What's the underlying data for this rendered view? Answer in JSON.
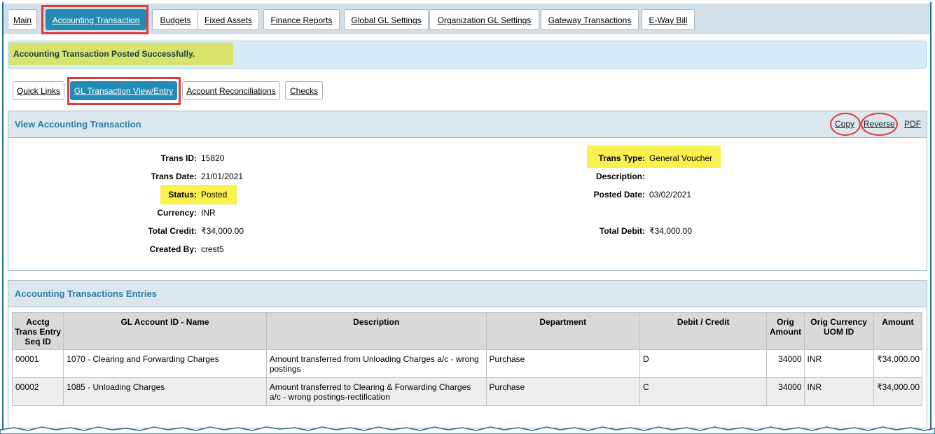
{
  "main_tabs": [
    {
      "label": "Main"
    },
    {
      "label": "Accounting Transaction"
    },
    {
      "label": "Budgets"
    },
    {
      "label": "Fixed Assets"
    },
    {
      "label": "Finance Reports"
    },
    {
      "label": "Global GL Settings"
    },
    {
      "label": "Organization GL Settings"
    },
    {
      "label": "Gateway Transactions"
    },
    {
      "label": "E-Way Bill"
    }
  ],
  "alert": {
    "message": "Accounting Transaction Posted Successfully."
  },
  "sub_tabs": [
    {
      "label": "Quick Links"
    },
    {
      "label": "GL Transaction View/Entry"
    },
    {
      "label": "Account Reconciliations"
    },
    {
      "label": "Checks"
    }
  ],
  "view_panel": {
    "title": "View Accounting Transaction",
    "actions": {
      "copy": "Copy",
      "reverse": "Reverse",
      "pdf": "PDF"
    },
    "fields": {
      "trans_id": {
        "label": "Trans ID:",
        "value": "15820"
      },
      "trans_date": {
        "label": "Trans Date:",
        "value": "21/01/2021"
      },
      "status": {
        "label": "Status:",
        "value": "Posted"
      },
      "currency": {
        "label": "Currency:",
        "value": "INR"
      },
      "total_credit": {
        "label": "Total Credit:",
        "value": "₹34,000.00"
      },
      "created_by": {
        "label": "Created By:",
        "value": "crest5"
      },
      "trans_type": {
        "label": "Trans Type:",
        "value": "General Voucher"
      },
      "description": {
        "label": "Description:",
        "value": ""
      },
      "posted_date": {
        "label": "Posted Date:",
        "value": "03/02/2021"
      },
      "total_debit": {
        "label": "Total Debit:",
        "value": "₹34,000.00"
      }
    }
  },
  "entries_panel": {
    "title": "Accounting Transactions Entries",
    "columns": [
      "Acctg Trans Entry Seq ID",
      "GL Account ID - Name",
      "Description",
      "Department",
      "Debit / Credit",
      "Orig Amount",
      "Orig Currency UOM ID",
      "Amount"
    ],
    "rows": [
      [
        "00001",
        "1070 - Clearing and Forwarding Charges",
        "Amount transferred from Unloading Charges a/c - wrong postings",
        "Purchase",
        "D",
        "34000",
        "INR",
        "₹34,000.00"
      ],
      [
        "00002",
        "1085 - Unloading Charges",
        "Amount transferred to Clearing & Forwarding Charges a/c - wrong postings-rectification",
        "Purchase",
        "C",
        "34000",
        "INR",
        "₹34,000.00"
      ]
    ]
  },
  "colors": {
    "accent": "#238bb3",
    "highlight_yellow": "#f8f14e",
    "annotation_red": "#e0393e",
    "panel_title": "#2a7fa8"
  }
}
